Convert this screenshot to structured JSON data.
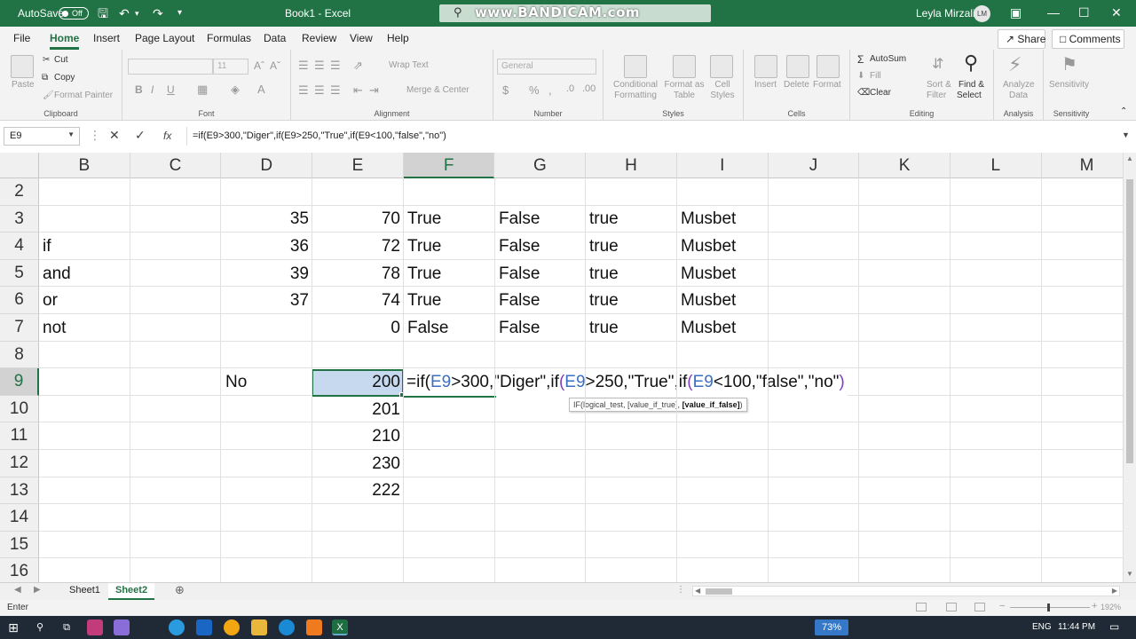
{
  "titlebar": {
    "autosave_label": "AutoSave",
    "autosave_state": "Off",
    "title": "Book1 - Excel",
    "watermark": "www.BANDICAM.com",
    "user_name": "Leyla Mirzali",
    "user_initials": "LM",
    "icons": [
      "save-icon",
      "undo-icon",
      "redo-icon",
      "customize-qat-icon",
      "search-icon",
      "ribbon-display-icon",
      "minimize-icon",
      "maximize-icon",
      "close-icon"
    ]
  },
  "tabs": [
    "File",
    "Home",
    "Insert",
    "Page Layout",
    "Formulas",
    "Data",
    "Review",
    "View",
    "Help"
  ],
  "active_tab": "Home",
  "share_label": "Share",
  "comments_label": "Comments",
  "ribbon": {
    "clipboard": {
      "paste": "Paste",
      "cut": "Cut",
      "copy": "Copy",
      "format_painter": "Format Painter",
      "label": "Clipboard"
    },
    "font": {
      "font_size": "11",
      "label": "Font",
      "bold": "B",
      "italic": "I",
      "underline": "U"
    },
    "alignment": {
      "wrap": "Wrap Text",
      "merge": "Merge & Center",
      "label": "Alignment"
    },
    "number": {
      "format": "General",
      "label": "Number"
    },
    "styles": {
      "conditional_1": "Conditional",
      "conditional_2": "Formatting",
      "format_table_1": "Format as",
      "format_table_2": "Table",
      "cell_styles_1": "Cell",
      "cell_styles_2": "Styles",
      "label": "Styles"
    },
    "cells": {
      "insert": "Insert",
      "delete": "Delete",
      "format": "Format",
      "label": "Cells"
    },
    "editing": {
      "autosum": "AutoSum",
      "fill": "Fill",
      "clear": "Clear",
      "sort_1": "Sort &",
      "sort_2": "Filter",
      "find_1": "Find &",
      "find_2": "Select",
      "label": "Editing"
    },
    "analysis": {
      "analyze_1": "Analyze",
      "analyze_2": "Data",
      "label": "Analysis"
    },
    "sensitivity": {
      "button": "Sensitivity",
      "label": "Sensitivity"
    }
  },
  "formula_bar": {
    "name_box": "E9",
    "fx": "fx",
    "formula": "=if(E9>300,\"Diger\",if(E9>250,\"True\",if(E9<100,\"false\",\"no\")"
  },
  "columns": [
    "B",
    "C",
    "D",
    "E",
    "F",
    "G",
    "H",
    "I",
    "J",
    "K",
    "L",
    "M"
  ],
  "rows": [
    "2",
    "3",
    "4",
    "5",
    "6",
    "7",
    "8",
    "9",
    "10",
    "11",
    "12",
    "13",
    "14",
    "15",
    "16"
  ],
  "cells": {
    "B4": "if",
    "B5": "and",
    "B6": "or",
    "B7": "not",
    "D3": "35",
    "D4": "36",
    "D5": "39",
    "D6": "37",
    "D9": "No",
    "E3": "70",
    "E4": "72",
    "E5": "78",
    "E6": "74",
    "E7": "0",
    "E9": "200",
    "E10": "201",
    "E11": "210",
    "E12": "230",
    "E13": "222",
    "F3": "True",
    "F4": "True",
    "F5": "True",
    "F6": "True",
    "F7": "False",
    "G3": "False",
    "G4": "False",
    "G5": "False",
    "G6": "False",
    "G7": "False",
    "H3": "true",
    "H4": "true",
    "H5": "true",
    "H6": "true",
    "H7": "true",
    "I3": "Musbet",
    "I4": "Musbet",
    "I5": "Musbet",
    "I6": "Musbet",
    "I7": "Musbet"
  },
  "in_cell_editor": {
    "s1": "=if(",
    "r1": "E9",
    "s2": ">300,\"Diger\",if",
    "p2": "(",
    "r2": "E9",
    "s3": ">250,\"True\",if",
    "p3": "(",
    "r3": "E9",
    "s4": "<100,\"false\",\"no\"",
    "p4": ")"
  },
  "tooltip": {
    "part1": "IF(logical_test, [value_if_true], ",
    "bold": "[value_if_false]",
    "part2": ")"
  },
  "sheets": [
    "Sheet1",
    "Sheet2"
  ],
  "active_sheet": "Sheet2",
  "status": {
    "mode": "Enter",
    "zoom": "192%"
  },
  "taskbar": {
    "battery": "73%",
    "language": "ENG",
    "time": "11:44 PM"
  },
  "colors": {
    "excel_green": "#217346",
    "selection": "#c6d9ef",
    "ref_blue": "#3a6fc4",
    "paren_purple": "#7c3fbf"
  }
}
